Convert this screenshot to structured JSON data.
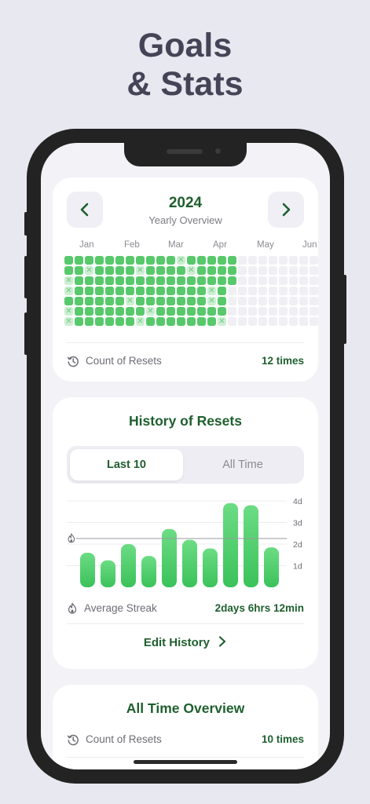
{
  "headline": {
    "line1": "Goals",
    "line2": "& Stats"
  },
  "colors": {
    "accent": "#1f5f2f",
    "bar_top": "#6cdc84",
    "bar_bottom": "#3bc25a",
    "cell_done": "#57c96b",
    "cell_missed": "#cdeed3",
    "cell_future": "#efeff4"
  },
  "icons": {
    "prev": "chevron-left-icon",
    "next": "chevron-right-icon",
    "resets": "history-clock-icon",
    "streak": "flame-icon",
    "average_marker": "flame-icon",
    "edit": "chevron-right-icon"
  },
  "yearly": {
    "year": "2024",
    "subtitle": "Yearly Overview",
    "months": [
      "Jan",
      "Feb",
      "Mar",
      "Apr",
      "May",
      "Jun"
    ],
    "heatmap": {
      "rows": 7,
      "cols": 25,
      "filled_through": [
        16,
        16,
        16,
        15,
        15,
        15,
        15
      ],
      "missed": [
        [
          0,
          11
        ],
        [
          1,
          2
        ],
        [
          1,
          7
        ],
        [
          1,
          12
        ],
        [
          2,
          0
        ],
        [
          3,
          0
        ],
        [
          3,
          14
        ],
        [
          4,
          6
        ],
        [
          4,
          14
        ],
        [
          5,
          0
        ],
        [
          5,
          8
        ],
        [
          6,
          0
        ],
        [
          6,
          7
        ],
        [
          6,
          15
        ]
      ]
    },
    "resets_label": "Count of Resets",
    "resets_value": "12 times"
  },
  "history": {
    "title": "History of Resets",
    "tabs": [
      {
        "label": "Last 10",
        "active": true
      },
      {
        "label": "All Time",
        "active": false
      }
    ],
    "chart_data": {
      "type": "bar",
      "y_tick_labels": [
        "4d",
        "3d",
        "2d",
        "1d"
      ],
      "ylim": [
        0,
        4
      ],
      "unit": "days",
      "values": [
        1.6,
        1.25,
        2.0,
        1.45,
        2.7,
        2.2,
        1.8,
        3.9,
        3.8,
        1.85
      ],
      "average": 2.26,
      "average_marker": true
    },
    "streak_label": "Average Streak",
    "streak_value": "2days 6hrs 12min",
    "edit_label": "Edit History"
  },
  "overview": {
    "title": "All Time Overview",
    "resets_label": "Count of Resets",
    "resets_value": "10 times"
  }
}
